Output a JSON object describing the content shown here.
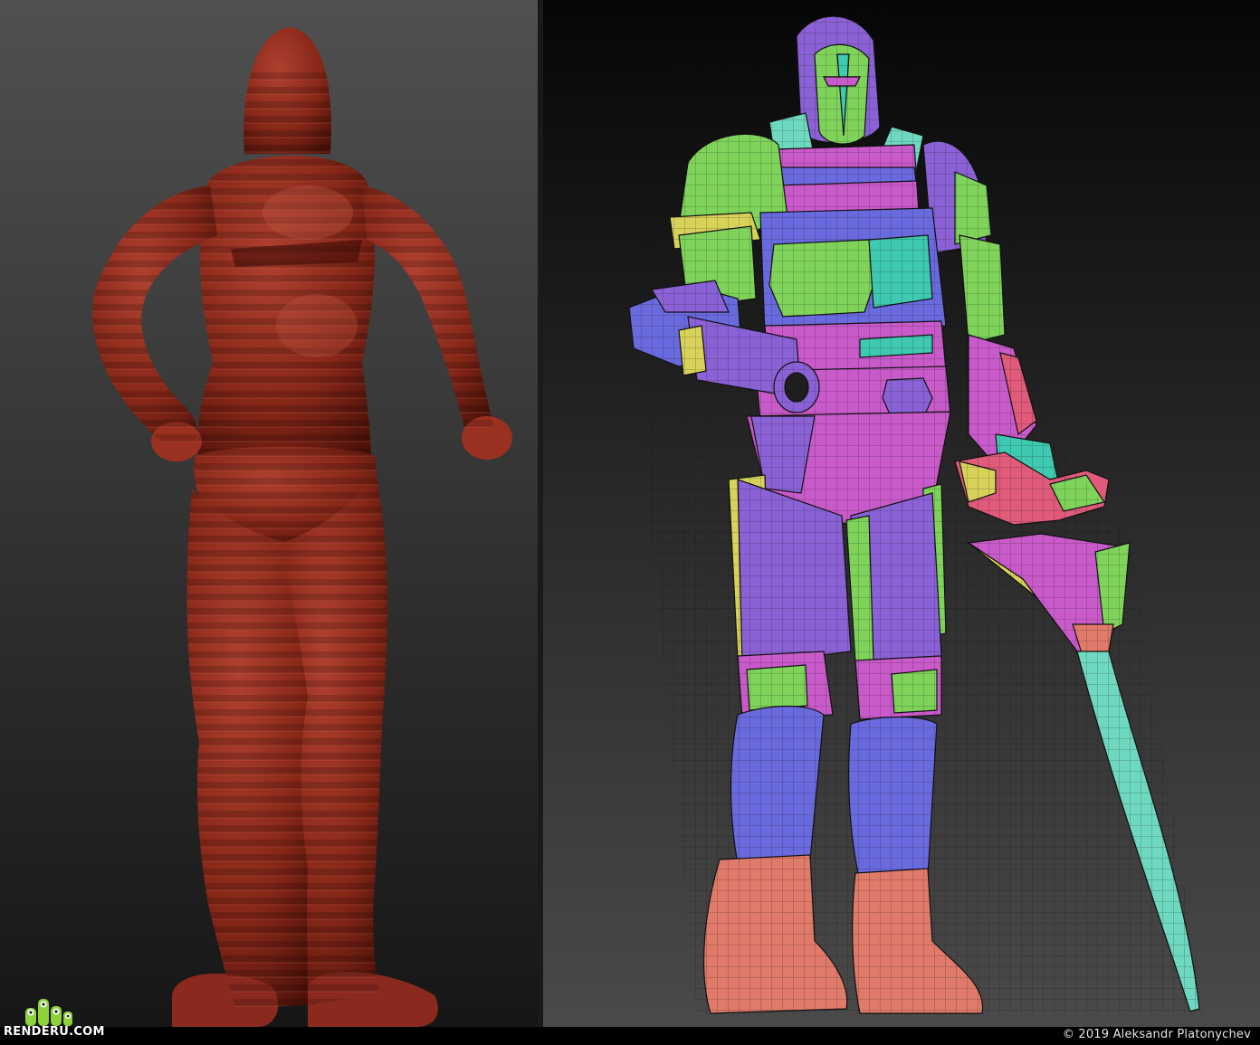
{
  "image": {
    "description_panels": [
      "base-mesh-mannequin",
      "armored-knight-retopology"
    ]
  },
  "left_model": {
    "body_color": "#8a2a1e",
    "band_color": "#6e1d14",
    "seam_color": "#b34a3a"
  },
  "right_model": {
    "polygroup_colors": [
      "#7fd35a",
      "#3fc9b0",
      "#8a62d6",
      "#c95ac9",
      "#e05a7a",
      "#6a6adf",
      "#d9d25a",
      "#e07a6a",
      "#6fd8c0"
    ],
    "wire_color": "#1a1a1a"
  },
  "watermark": {
    "logo_text": "RENDERU.COM",
    "logo_color": "#8fd13b",
    "copyright": "© 2019 Aleksandr Platonychev"
  }
}
